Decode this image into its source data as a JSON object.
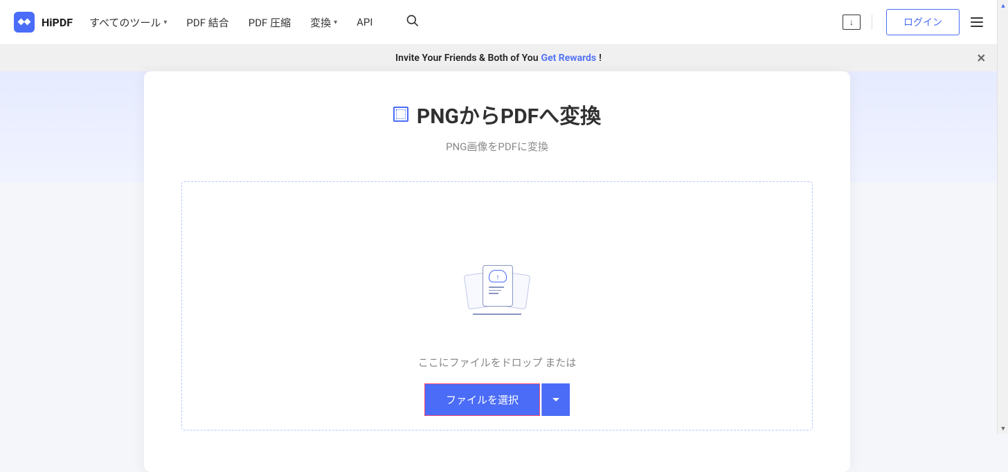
{
  "brand": "HiPDF",
  "nav": {
    "all_tools": "すべてのツール",
    "merge": "PDF 結合",
    "compress": "PDF 圧縮",
    "convert": "変換",
    "api": "API"
  },
  "header": {
    "login": "ログイン"
  },
  "banner": {
    "prefix": "Invite Your Friends & Both of You ",
    "link": "Get Rewards",
    "suffix": " !"
  },
  "page": {
    "title": "PNGからPDFへ変換",
    "subtitle": "PNG画像をPDFに変換",
    "drop_text": "ここにファイルをドロップ または",
    "select_button": "ファイルを選択"
  }
}
